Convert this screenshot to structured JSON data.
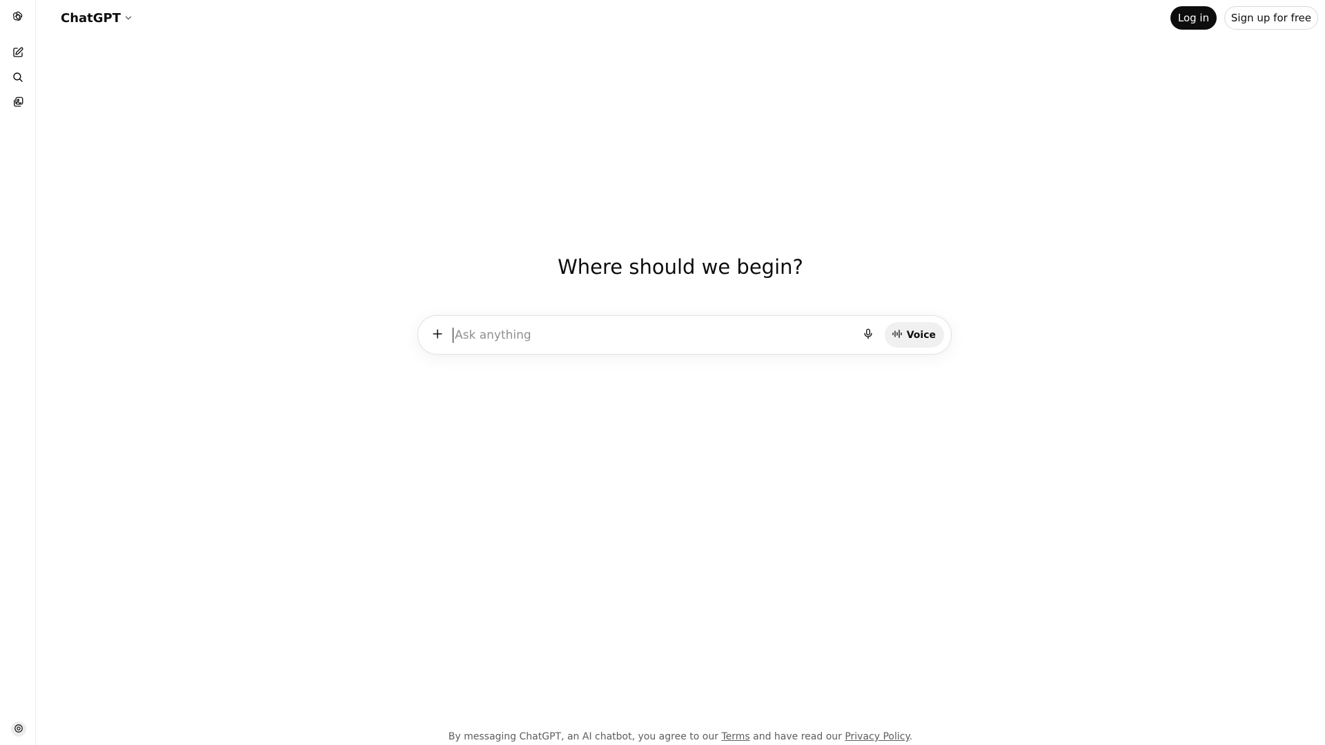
{
  "header": {
    "model_label": "ChatGPT",
    "login_label": "Log in",
    "signup_label": "Sign up for free"
  },
  "sidebar": {
    "items": [
      {
        "icon": "openai-logo-icon"
      },
      {
        "icon": "new-chat-icon"
      },
      {
        "icon": "search-icon"
      },
      {
        "icon": "library-icon"
      }
    ],
    "bottom_icon": "help-icon"
  },
  "main": {
    "heading": "Where should we begin?"
  },
  "composer": {
    "placeholder": "Ask anything",
    "voice_label": "Voice"
  },
  "footer": {
    "prefix": "By messaging ChatGPT, an AI chatbot, you agree to our",
    "terms": "Terms",
    "middle": "and have read our",
    "privacy": "Privacy Policy",
    "suffix": "."
  },
  "colors": {
    "primary_button": "#0d0d0d",
    "voice_button_bg": "#f0f0f0",
    "border": "#e3e3e3"
  }
}
